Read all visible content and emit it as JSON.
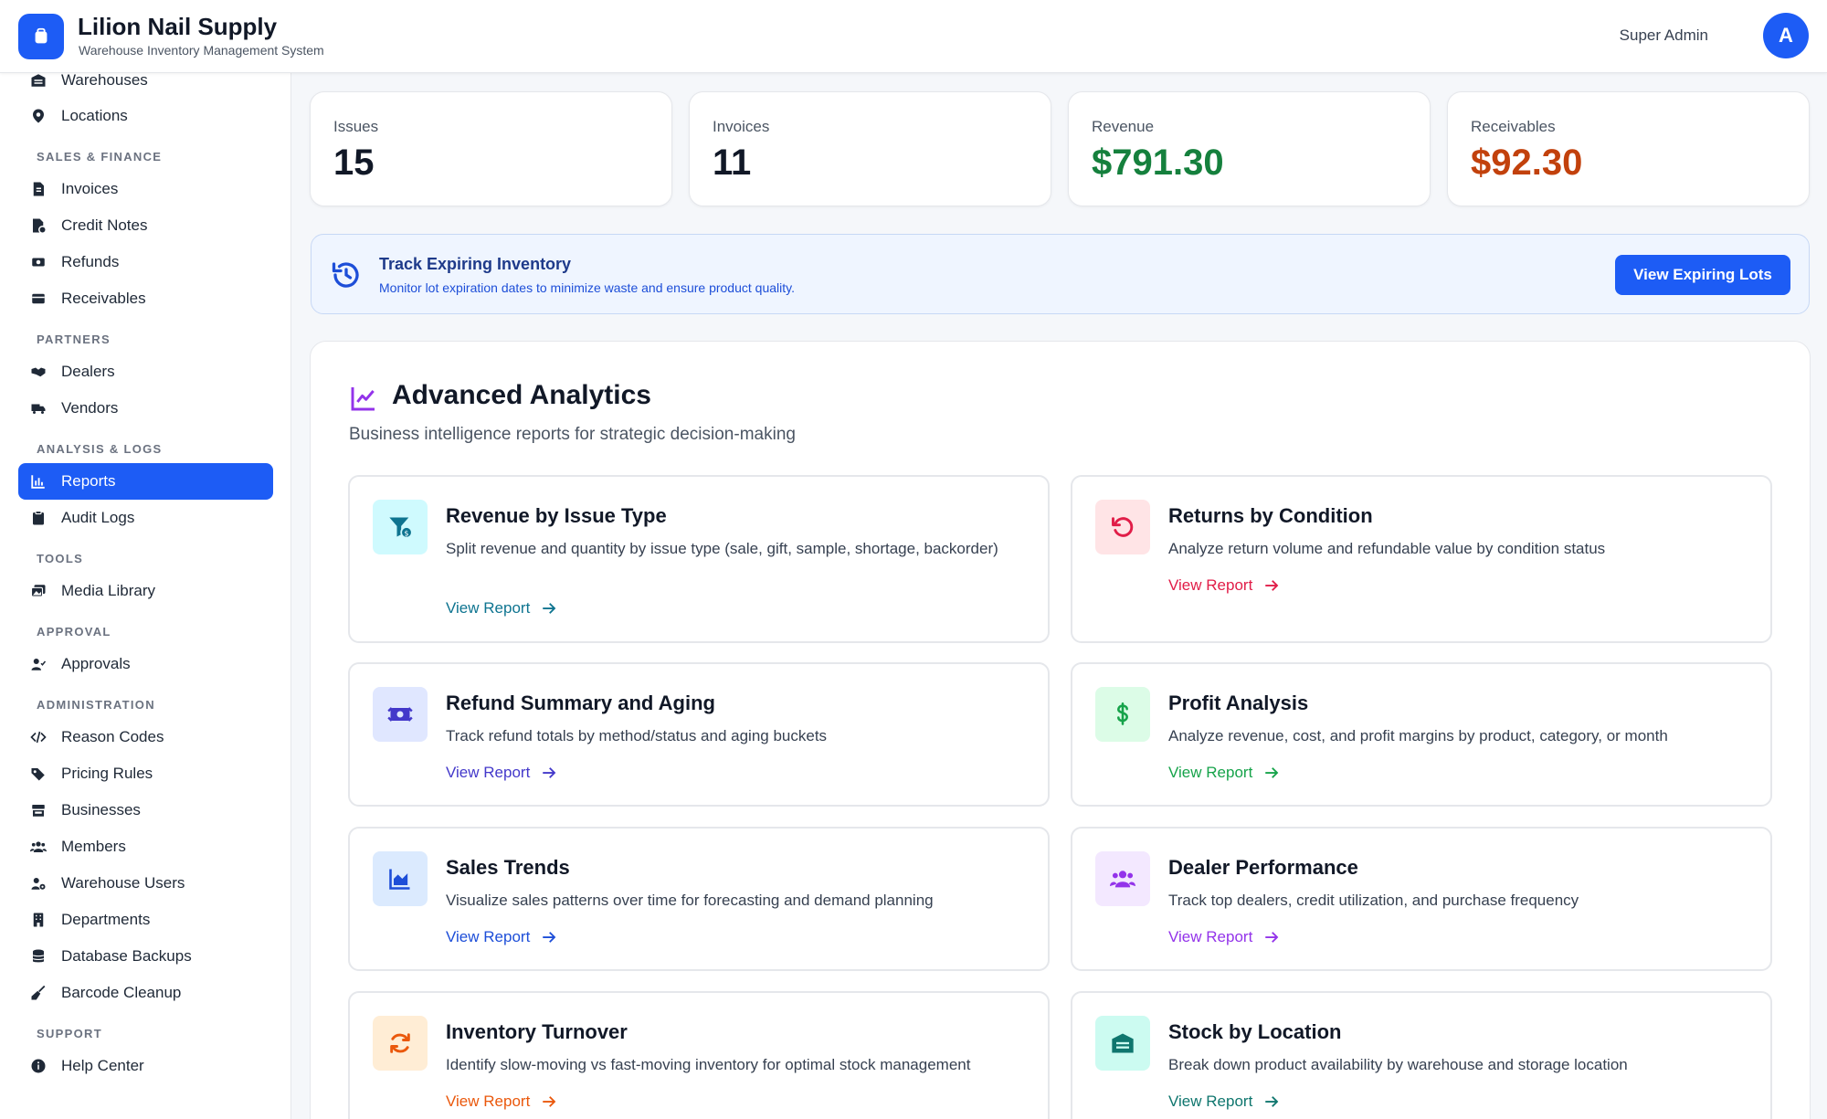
{
  "header": {
    "title": "Lilion Nail Supply",
    "subtitle": "Warehouse Inventory Management System",
    "user": "Super Admin",
    "avatar_initial": "A"
  },
  "sidebar": {
    "items": [
      {
        "label": "Warehouses",
        "icon": "warehouse-icon"
      },
      {
        "label": "Locations",
        "icon": "map-pin-icon"
      },
      {
        "section": "SALES & FINANCE"
      },
      {
        "label": "Invoices",
        "icon": "invoice-icon"
      },
      {
        "label": "Credit Notes",
        "icon": "credit-note-icon"
      },
      {
        "label": "Refunds",
        "icon": "refund-icon"
      },
      {
        "label": "Receivables",
        "icon": "wallet-icon"
      },
      {
        "section": "PARTNERS"
      },
      {
        "label": "Dealers",
        "icon": "handshake-icon"
      },
      {
        "label": "Vendors",
        "icon": "truck-icon"
      },
      {
        "section": "ANALYSIS & LOGS"
      },
      {
        "label": "Reports",
        "icon": "chart-bar-icon",
        "active": true
      },
      {
        "label": "Audit Logs",
        "icon": "clipboard-icon"
      },
      {
        "section": "TOOLS"
      },
      {
        "label": "Media Library",
        "icon": "images-icon"
      },
      {
        "section": "APPROVAL"
      },
      {
        "label": "Approvals",
        "icon": "user-check-icon"
      },
      {
        "section": "ADMINISTRATION"
      },
      {
        "label": "Reason Codes",
        "icon": "code-icon"
      },
      {
        "label": "Pricing Rules",
        "icon": "tags-icon"
      },
      {
        "label": "Businesses",
        "icon": "store-icon"
      },
      {
        "label": "Members",
        "icon": "users-icon"
      },
      {
        "label": "Warehouse Users",
        "icon": "user-gear-icon"
      },
      {
        "label": "Departments",
        "icon": "building-icon"
      },
      {
        "label": "Database Backups",
        "icon": "database-icon"
      },
      {
        "label": "Barcode Cleanup",
        "icon": "broom-icon"
      },
      {
        "section": "SUPPORT"
      },
      {
        "label": "Help Center",
        "icon": "info-circle-icon"
      }
    ]
  },
  "stats": [
    {
      "label": "Issues",
      "value": "15",
      "color": "#111827"
    },
    {
      "label": "Invoices",
      "value": "11",
      "color": "#111827"
    },
    {
      "label": "Revenue",
      "value": "$791.30",
      "color": "#15803d"
    },
    {
      "label": "Receivables",
      "value": "$92.30",
      "color": "#c2410c"
    }
  ],
  "banner": {
    "title": "Track Expiring Inventory",
    "text": "Monitor lot expiration dates to minimize waste and ensure product quality.",
    "button": "View Expiring Lots"
  },
  "analytics": {
    "title": "Advanced Analytics",
    "subtitle": "Business intelligence reports for strategic decision-making",
    "link_label": "View Report",
    "reports": [
      {
        "title": "Revenue by Issue Type",
        "desc": "Split revenue and quantity by issue type (sale, gift, sample, shortage, backorder)",
        "icon": "funnel-dollar-icon",
        "color": "#0e7490",
        "bg": "#cffafe"
      },
      {
        "title": "Returns by Condition",
        "desc": "Analyze return volume and refundable value by condition status",
        "icon": "rotate-left-icon",
        "color": "#e11d48",
        "bg": "#ffe4e6"
      },
      {
        "title": "Refund Summary and Aging",
        "desc": "Track refund totals by method/status and aging buckets",
        "icon": "money-transfer-icon",
        "color": "#4338ca",
        "bg": "#e0e7ff"
      },
      {
        "title": "Profit Analysis",
        "desc": "Analyze revenue, cost, and profit margins by product, category, or month",
        "icon": "dollar-icon",
        "color": "#16a34a",
        "bg": "#dcfce7"
      },
      {
        "title": "Sales Trends",
        "desc": "Visualize sales patterns over time for forecasting and demand planning",
        "icon": "area-chart-icon",
        "color": "#1d4ed8",
        "bg": "#dbeafe"
      },
      {
        "title": "Dealer Performance",
        "desc": "Track top dealers, credit utilization, and purchase frequency",
        "icon": "users-icon",
        "color": "#9333ea",
        "bg": "#f3e8ff"
      },
      {
        "title": "Inventory Turnover",
        "desc": "Identify slow-moving vs fast-moving inventory for optimal stock management",
        "icon": "rotate-icon",
        "color": "#ea580c",
        "bg": "#ffedd5"
      },
      {
        "title": "Stock by Location",
        "desc": "Break down product availability by warehouse and storage location",
        "icon": "warehouse-icon",
        "color": "#0f766e",
        "bg": "#ccfbf1"
      }
    ]
  }
}
